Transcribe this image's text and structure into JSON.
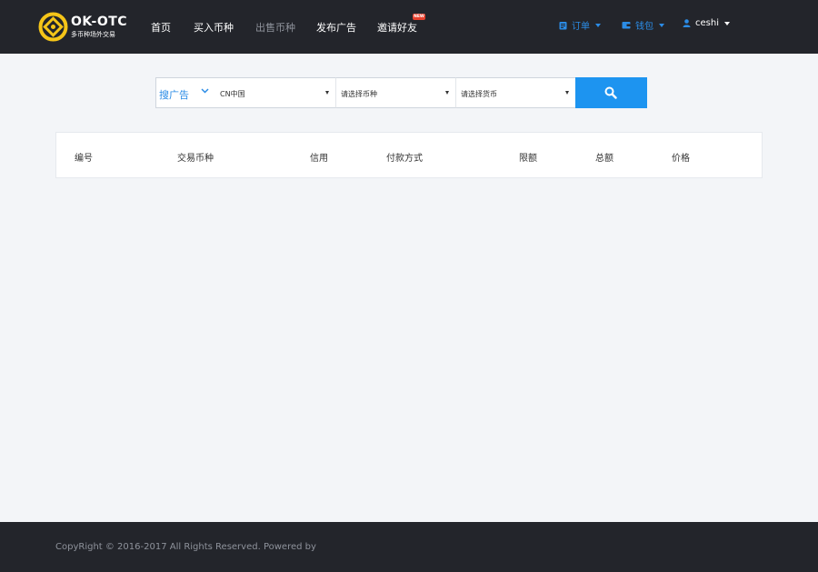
{
  "brand": {
    "name": "OK-OTC",
    "tagline": "多币种场外交易",
    "color": "#f5c518"
  },
  "nav": {
    "items": [
      {
        "label": "首页"
      },
      {
        "label": "买入币种"
      },
      {
        "label": "出售币种"
      },
      {
        "label": "发布广告"
      },
      {
        "label": "邀请好友"
      }
    ],
    "new_badge": "NEW"
  },
  "right_nav": {
    "orders": "订单",
    "wallet": "钱包",
    "user": "ceshi"
  },
  "search": {
    "type_label": "搜广告",
    "country": "CN中国",
    "coin_placeholder": "请选择币种",
    "currency_placeholder": "请选择货币",
    "icon": "search-icon"
  },
  "table": {
    "headers": [
      "编号",
      "交易币种",
      "信用",
      "付款方式",
      "限额",
      "总额",
      "价格"
    ]
  },
  "footer": {
    "copyright": "CopyRight © 2016-2017 All Rights Reserved. Powered by"
  },
  "colors": {
    "header_bg": "#23252b",
    "accent": "#2b8ce6",
    "button": "#1d94f0",
    "page_bg": "#f3f5f8"
  }
}
